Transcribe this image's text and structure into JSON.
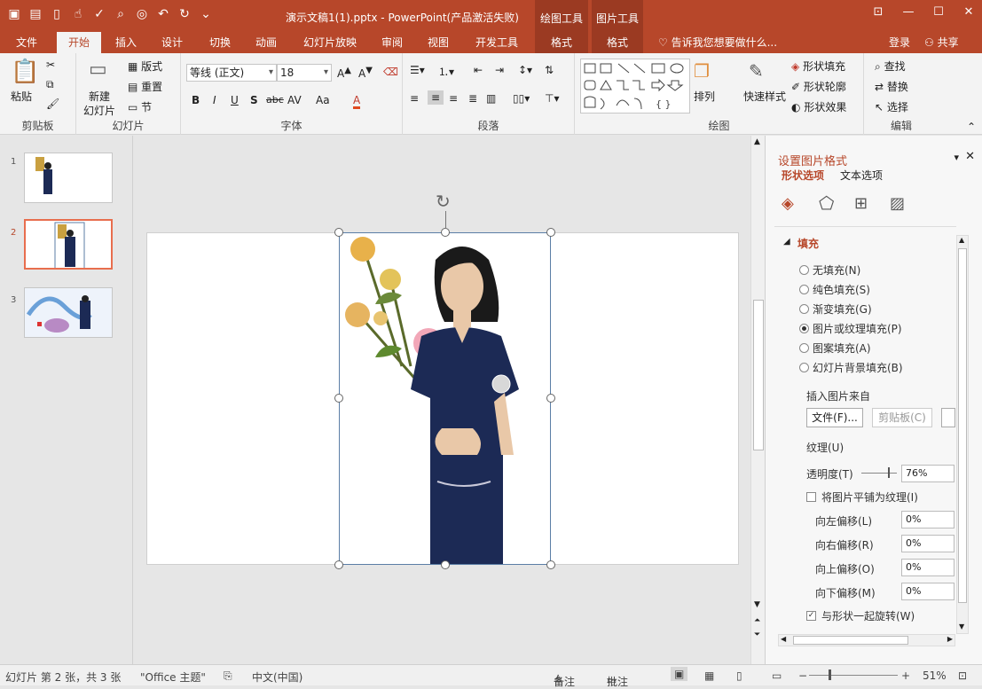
{
  "window": {
    "doc_title": "演示文稿1(1).pptx - PowerPoint(产品激活失败)",
    "context_groups": [
      "绘图工具",
      "图片工具"
    ],
    "signin": "登录",
    "share": "共享",
    "tellme": "告诉我您想要做什么..."
  },
  "tabs": [
    "文件",
    "开始",
    "插入",
    "设计",
    "切换",
    "动画",
    "幻灯片放映",
    "审阅",
    "视图",
    "开发工具",
    "格式",
    "格式"
  ],
  "ribbon": {
    "clipboard": {
      "paste": "粘贴",
      "label": "剪贴板"
    },
    "slides": {
      "new_slide_line1": "新建",
      "new_slide_line2": "幻灯片",
      "layout": "版式",
      "reset": "重置",
      "section": "节",
      "label": "幻灯片"
    },
    "font": {
      "name": "等线 (正文)",
      "size": "18",
      "bold": "B",
      "italic": "I",
      "underline": "U",
      "shadow": "S",
      "strike": "abc",
      "spacing": "AV",
      "case": "Aa",
      "color": "A",
      "label": "字体"
    },
    "paragraph": {
      "label": "段落"
    },
    "drawing": {
      "arrange": "排列",
      "quick_styles": "快速样式",
      "shape_fill": "形状填充",
      "shape_outline": "形状轮廓",
      "shape_effect": "形状效果",
      "label": "绘图"
    },
    "editing": {
      "find": "查找",
      "replace": "替换",
      "select": "选择",
      "label": "编辑"
    }
  },
  "slides": [
    {
      "num": "1"
    },
    {
      "num": "2"
    },
    {
      "num": "3"
    }
  ],
  "panel": {
    "title": "设置图片格式",
    "tab_shape": "形状选项",
    "tab_text": "文本选项",
    "section_fill": "填充",
    "fill_options": [
      {
        "label": "无填充(N)",
        "selected": false
      },
      {
        "label": "纯色填充(S)",
        "selected": false
      },
      {
        "label": "渐变填充(G)",
        "selected": false
      },
      {
        "label": "图片或纹理填充(P)",
        "selected": true
      },
      {
        "label": "图案填充(A)",
        "selected": false
      },
      {
        "label": "幻灯片背景填充(B)",
        "selected": false
      }
    ],
    "insert_from": "插入图片来自",
    "file_btn": "文件(F)...",
    "clipboard_btn": "剪贴板(C)",
    "texture": "纹理(U)",
    "transparency_label": "透明度(T)",
    "transparency_value": "76%",
    "tile_label": "将图片平铺为纹理(I)",
    "offset_left_label": "向左偏移(L)",
    "offset_left": "0%",
    "offset_right_label": "向右偏移(R)",
    "offset_right": "0%",
    "offset_top_label": "向上偏移(O)",
    "offset_top": "0%",
    "offset_bottom_label": "向下偏移(M)",
    "offset_bottom": "0%",
    "rotate_label": "与形状一起旋转(W)"
  },
  "status": {
    "slide_info": "幻灯片 第 2 张，共 3 张",
    "theme": "\"Office 主题\"",
    "language": "中文(中国)",
    "notes": "备注",
    "comments": "批注",
    "zoom": "51%"
  },
  "colors": {
    "accent": "#b7472a",
    "selection": "#e86e4e"
  }
}
